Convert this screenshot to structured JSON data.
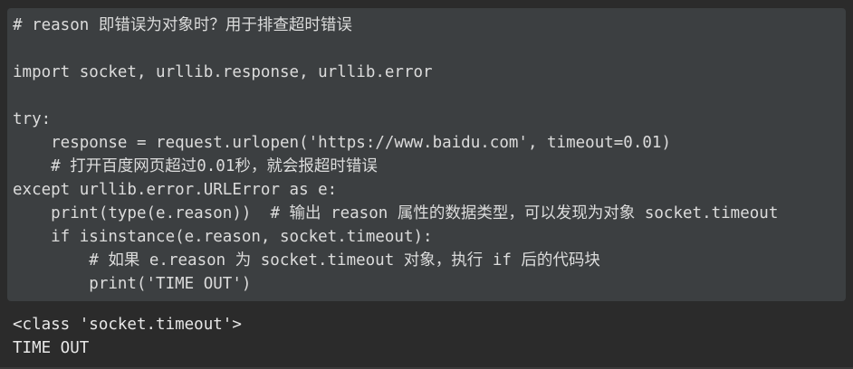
{
  "code_cell": {
    "lines": [
      "# reason 即错误为对象时？用于排查超时错误",
      "",
      "import socket, urllib.response, urllib.error",
      "",
      "try:",
      "    response = request.urlopen('https://www.baidu.com', timeout=0.01)",
      "    # 打开百度网页超过0.01秒，就会报超时错误",
      "except urllib.error.URLError as e:",
      "    print(type(e.reason))  # 输出 reason 属性的数据类型，可以发现为对象 socket.timeout",
      "    if isinstance(e.reason, socket.timeout):",
      "        # 如果 e.reason 为 socket.timeout 对象，执行 if 后的代码块",
      "        print('TIME OUT')"
    ]
  },
  "output": {
    "lines": [
      "<class 'socket.timeout'>",
      "TIME OUT"
    ]
  },
  "colors": {
    "page_background": "#2b2b2b",
    "cell_background": "#3c3f41",
    "code_text": "#dcdcdc",
    "output_text": "#e8e8e8"
  }
}
